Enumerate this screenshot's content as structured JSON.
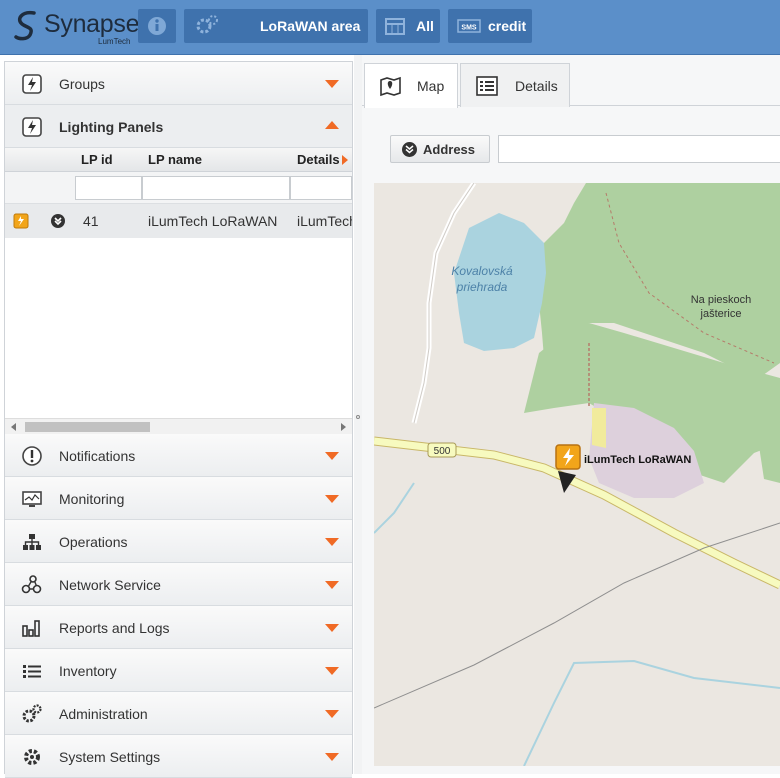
{
  "app": {
    "brand": "Synapse",
    "brand_sub": "LumTech"
  },
  "topbar": {
    "area_label": "LoRaWAN area",
    "filter_label": "All",
    "credit_label": "credit",
    "sms_text": "SMS"
  },
  "left_panel": {
    "groups": {
      "label": "Groups",
      "icon": "lightning-icon"
    },
    "lighting_panels": {
      "label": "Lighting Panels",
      "icon": "lightning-icon",
      "columns": [
        "LP id",
        "LP name",
        "Details"
      ],
      "rows": [
        {
          "id": "41",
          "name": "iLumTech LoRaWAN",
          "details": "iLumTech"
        }
      ]
    },
    "sections": [
      {
        "label": "Notifications",
        "icon": "exclamation-icon"
      },
      {
        "label": "Monitoring",
        "icon": "monitor-icon"
      },
      {
        "label": "Operations",
        "icon": "hierarchy-icon"
      },
      {
        "label": "Network Service",
        "icon": "network-icon"
      },
      {
        "label": "Reports and Logs",
        "icon": "bar-chart-icon"
      },
      {
        "label": "Inventory",
        "icon": "list-icon"
      },
      {
        "label": "Administration",
        "icon": "gears-icon"
      },
      {
        "label": "System Settings",
        "icon": "gear-icon"
      }
    ]
  },
  "tabs": [
    {
      "label": "Map",
      "icon": "map-icon",
      "active": true
    },
    {
      "label": "Details",
      "icon": "details-icon",
      "active": false
    }
  ],
  "address": {
    "button_label": "Address",
    "value": ""
  },
  "map": {
    "labels": {
      "reservoir": [
        "Kovalovská",
        "priehrada"
      ],
      "area": [
        "Na pieskoch",
        "jašterice"
      ],
      "road_number": "500"
    },
    "marker_label": "iLumTech LoRaWAN"
  },
  "colors": {
    "accent": "#f06a25",
    "topbar": "#5b8fc9",
    "topbar_button": "#3f72ad",
    "forest": "#aed0a0",
    "water": "#aad3df",
    "road": "#f7fabf"
  }
}
